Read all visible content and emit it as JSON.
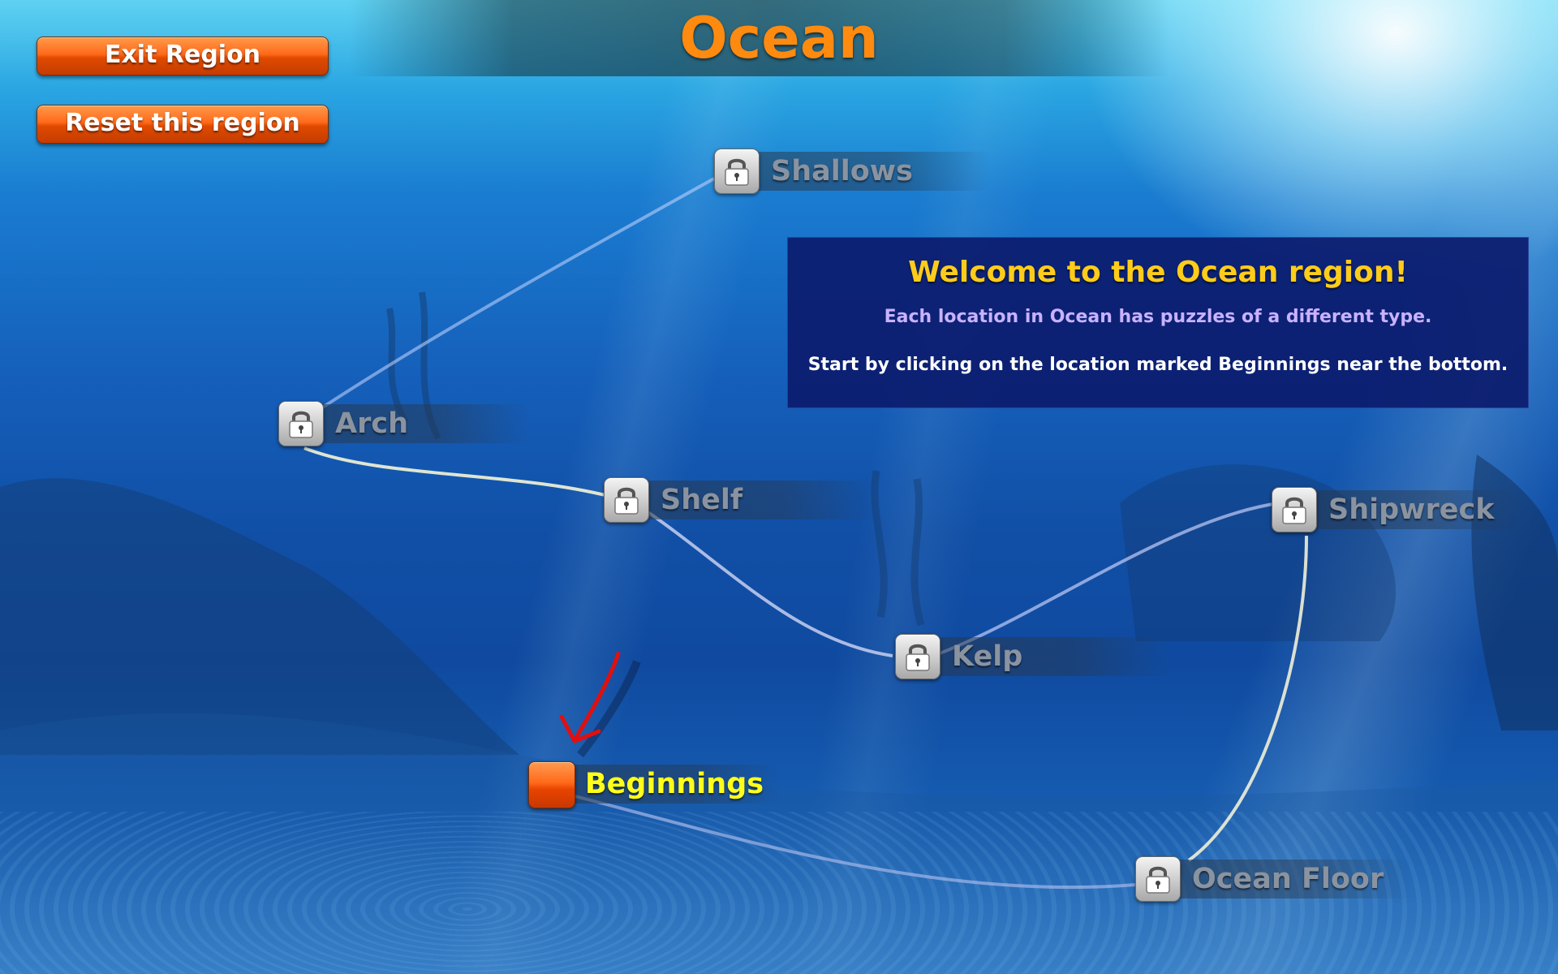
{
  "region": {
    "title": "Ocean"
  },
  "buttons": {
    "exit_label": "Exit Region",
    "reset_label": "Reset this region"
  },
  "info": {
    "title": "Welcome to the Ocean region!",
    "line1": "Each location in Ocean has puzzles of a different type.",
    "line2": "Start by clicking on the location marked Beginnings near the bottom."
  },
  "locations": {
    "beginnings": {
      "label": "Beginnings",
      "locked": false
    },
    "shallows": {
      "label": "Shallows",
      "locked": true
    },
    "arch": {
      "label": "Arch",
      "locked": true
    },
    "shelf": {
      "label": "Shelf",
      "locked": true
    },
    "kelp": {
      "label": "Kelp",
      "locked": true
    },
    "shipwreck": {
      "label": "Shipwreck",
      "locked": true
    },
    "ocean_floor": {
      "label": "Ocean Floor",
      "locked": true
    }
  },
  "icons": {
    "lock": "padlock-icon",
    "start": "start-square-icon",
    "hint": "red-arrow-icon"
  },
  "colors": {
    "title": "#ff8a10",
    "button": "#ff6a1a",
    "active_label": "#ffff1a",
    "locked_label": "#8a93a0",
    "info_title": "#ffcc1a",
    "info_bg": "#0c1c6e",
    "hint_arrow": "#e01010"
  }
}
